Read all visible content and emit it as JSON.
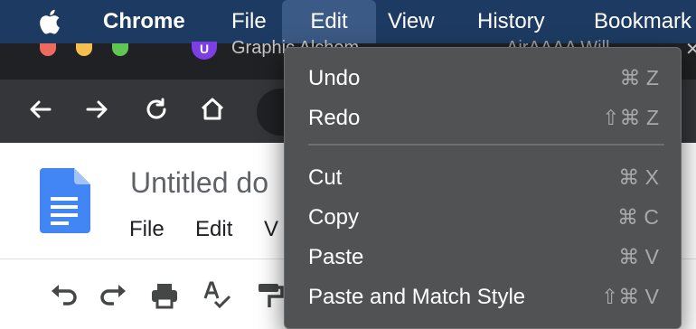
{
  "menubar": {
    "apple": "",
    "app": "Chrome",
    "items": [
      "File",
      "Edit",
      "View",
      "History",
      "Bookmark"
    ]
  },
  "tabs": {
    "tab1_icon": "U",
    "tab1_title": "Graphic Alchem",
    "tab2_title": "AirAAAA Will",
    "tab2_close": "✕"
  },
  "docs": {
    "title": "Untitled do",
    "menu": [
      "File",
      "Edit",
      "V"
    ]
  },
  "edit_menu": {
    "items": [
      {
        "label": "Undo",
        "shortcut": "⌘ Z"
      },
      {
        "label": "Redo",
        "shortcut": "⇧⌘ Z"
      },
      {
        "label": "Cut",
        "shortcut": "⌘ X"
      },
      {
        "label": "Copy",
        "shortcut": "⌘ C"
      },
      {
        "label": "Paste",
        "shortcut": "⌘ V"
      },
      {
        "label": "Paste and Match Style",
        "shortcut": "⇧⌘ V"
      }
    ]
  },
  "icons": {
    "nav": [
      "back-arrow-icon",
      "forward-arrow-icon",
      "reload-icon",
      "home-icon"
    ],
    "docs_tools": [
      "undo-icon",
      "redo-icon",
      "print-icon",
      "spellcheck-icon",
      "paint-format-icon"
    ]
  },
  "colors": {
    "menubar": "#1d3b62",
    "menubar_active": "#3b5a85",
    "dropdown_bg": "#515254",
    "chrome_toolbar": "#35363a",
    "docs_blue": "#4285f4"
  }
}
